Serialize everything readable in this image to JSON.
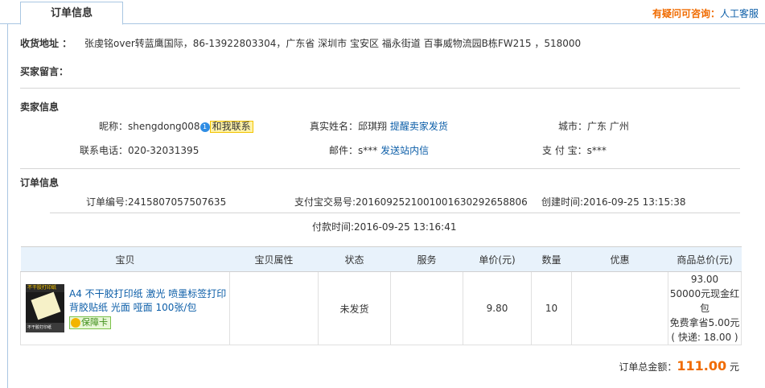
{
  "tab": {
    "label": "订单信息"
  },
  "consult": {
    "question": "有疑问可咨询：",
    "service": "人工客服"
  },
  "address": {
    "label": "收货地址 ：",
    "value": "张虔铭over转蓝鹰国际，86-13922803304，广东省 深圳市 宝安区 福永街道 百事威物流园B栋FW215 ，518000"
  },
  "buyer_message": {
    "label": "买家留言："
  },
  "seller": {
    "title": "卖家信息",
    "nickname_label": "昵称：",
    "nickname": "shengdong008",
    "contact_label": "和我联系",
    "realname_label": "真实姓名：",
    "realname": "邱琪翔",
    "remind_label": "提醒卖家发货",
    "city_label": "城市：",
    "city": "广东 广州",
    "phone_label": "联系电话：",
    "phone": "020-32031395",
    "email_label": "邮件：",
    "email": "s***",
    "sitemsg_label": "发送站内信",
    "alipay_label": "支 付 宝：",
    "alipay": "s***"
  },
  "order": {
    "title": "订单信息",
    "order_no": "订单编号:2415807057507635",
    "alipay_no": "支付宝交易号:2016092521001001630292658806",
    "created": "创建时间:2016-09-25 13:15:38",
    "paid": "付款时间:2016-09-25 13:16:41"
  },
  "table": {
    "headers": [
      "宝贝",
      "宝贝属性",
      "状态",
      "服务",
      "单价(元)",
      "数量",
      "优惠",
      "商品总价(元)"
    ],
    "rows": [
      {
        "title": "A4 不干胶打印纸 激光 喷墨标签打印背胶贴纸 光面 哑面 100张/包",
        "badge": "保障卡",
        "thumb_top_text": "不干胶打印纸",
        "thumb_bottom_text": "不干胶打印纸",
        "attributes": "",
        "status": "未发货",
        "service": "",
        "price": "9.80",
        "qty": "10",
        "discount": "",
        "total_line1": "93.00",
        "total_line2": "50000元现金红包",
        "total_line3": "免费拿省5.00元",
        "total_line4": "( 快递: 18.00 )"
      }
    ]
  },
  "grand_total": {
    "label": "订单总金额：",
    "amount": "111.00",
    "unit": "元"
  },
  "colors": {
    "accent": "#f06b00",
    "link": "#0c5ea8",
    "header_bg": "#e8f2fb",
    "border": "#a9c6e2"
  }
}
